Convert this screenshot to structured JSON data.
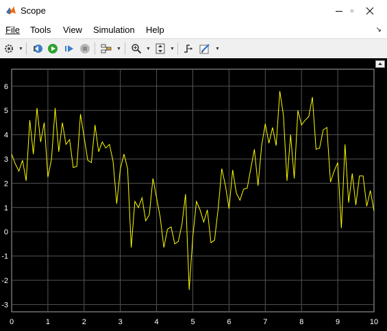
{
  "window": {
    "title": "Scope"
  },
  "menu": [
    {
      "label": "File"
    },
    {
      "label": "Tools"
    },
    {
      "label": "View"
    },
    {
      "label": "Simulation"
    },
    {
      "label": "Help"
    }
  ],
  "toolbar": {
    "icons": [
      "settings-icon",
      "step-back-icon",
      "run-icon",
      "step-forward-icon",
      "stop-icon",
      "highlight-icon",
      "zoom-icon",
      "autoscale-icon",
      "trigger-icon",
      "edit-style-icon"
    ]
  },
  "colors": {
    "plot_bg": "#000000",
    "trace": "#ffff00",
    "grid": "#555555",
    "tick_text": "#ffffff"
  },
  "chart_data": {
    "type": "line",
    "xlim": [
      0,
      10
    ],
    "ylim": [
      -3.3,
      6.7
    ],
    "xticks": [
      "0",
      "1",
      "2",
      "3",
      "4",
      "5",
      "6",
      "7",
      "8",
      "9",
      "10"
    ],
    "yticks": [
      "-3",
      "-2",
      "-1",
      "0",
      "1",
      "2",
      "3",
      "4",
      "5",
      "6"
    ],
    "grid": true,
    "series": [
      {
        "x": [
          0.0,
          0.1,
          0.2,
          0.3,
          0.4,
          0.5,
          0.6,
          0.7,
          0.8,
          0.9,
          1.0,
          1.1,
          1.2,
          1.3,
          1.4,
          1.5,
          1.6,
          1.7,
          1.8,
          1.9,
          2.0,
          2.1,
          2.2,
          2.3,
          2.4,
          2.5,
          2.6,
          2.7,
          2.8,
          2.9,
          3.0,
          3.1,
          3.2,
          3.3,
          3.4,
          3.5,
          3.6,
          3.7,
          3.8,
          3.9,
          4.0,
          4.1,
          4.2,
          4.3,
          4.4,
          4.5,
          4.6,
          4.7,
          4.8,
          4.9,
          5.0,
          5.1,
          5.2,
          5.3,
          5.4,
          5.5,
          5.6,
          5.7,
          5.8,
          5.9,
          6.0,
          6.1,
          6.2,
          6.3,
          6.4,
          6.5,
          6.6,
          6.7,
          6.8,
          6.9,
          7.0,
          7.1,
          7.2,
          7.3,
          7.4,
          7.5,
          7.6,
          7.7,
          7.8,
          7.9,
          8.0,
          8.1,
          8.2,
          8.3,
          8.4,
          8.5,
          8.6,
          8.7,
          8.8,
          8.9,
          9.0,
          9.1,
          9.2,
          9.3,
          9.4,
          9.5,
          9.6,
          9.7,
          9.8,
          9.9,
          10.0
        ],
        "y": [
          3.2,
          2.8,
          2.5,
          2.95,
          2.1,
          4.6,
          3.2,
          5.1,
          3.7,
          4.5,
          2.25,
          3.0,
          5.1,
          3.3,
          4.5,
          3.6,
          3.8,
          2.65,
          2.7,
          4.85,
          3.9,
          2.95,
          2.85,
          4.4,
          3.3,
          3.7,
          3.45,
          3.6,
          2.9,
          1.15,
          2.6,
          3.2,
          2.6,
          -0.65,
          1.25,
          1.0,
          1.4,
          0.45,
          0.7,
          2.2,
          1.4,
          0.6,
          -0.65,
          0.1,
          0.2,
          -0.5,
          -0.4,
          0.3,
          1.55,
          -2.4,
          -0.2,
          1.25,
          0.9,
          0.4,
          0.9,
          -0.45,
          -0.35,
          0.95,
          2.6,
          1.9,
          0.95,
          2.55,
          1.6,
          1.3,
          1.75,
          1.8,
          2.6,
          3.4,
          1.9,
          3.55,
          4.45,
          3.65,
          4.3,
          3.55,
          5.8,
          4.8,
          2.1,
          4.0,
          2.2,
          5.0,
          4.4,
          4.6,
          4.75,
          5.55,
          3.4,
          3.45,
          4.2,
          4.3,
          2.05,
          2.5,
          2.85,
          0.15,
          3.6,
          1.2,
          2.4,
          1.1,
          2.3,
          2.3,
          1.05,
          1.7,
          0.85
        ]
      }
    ]
  }
}
